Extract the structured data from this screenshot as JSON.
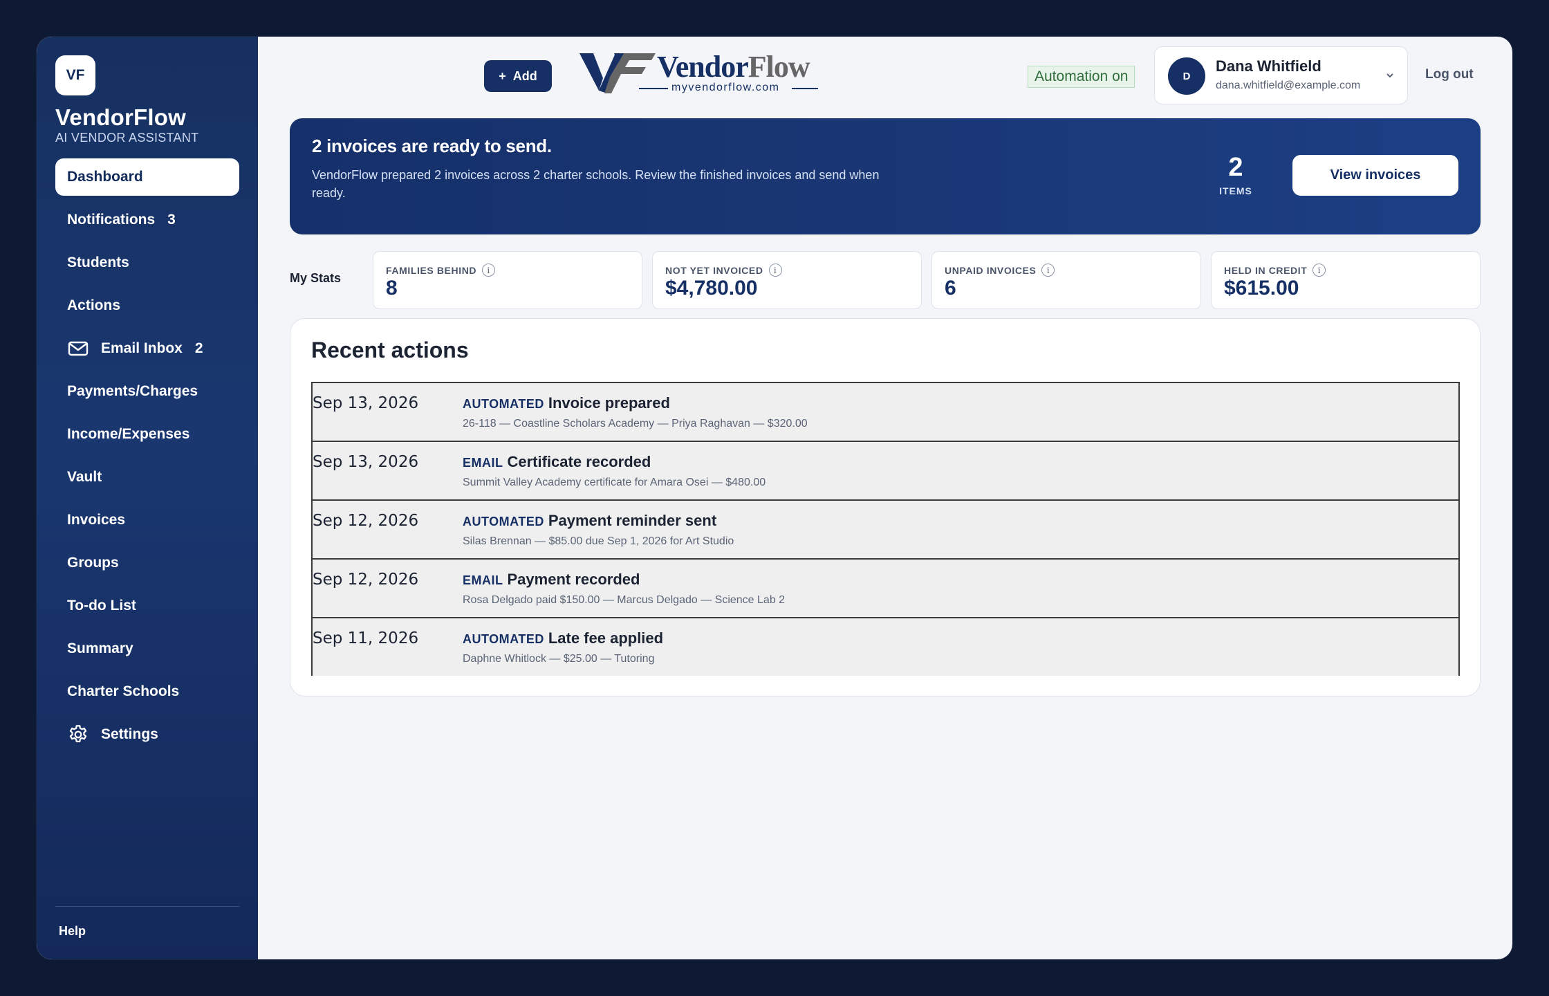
{
  "sidebar": {
    "logo_initials": "VF",
    "brand_name": "VendorFlow",
    "brand_subtitle": "AI VENDOR ASSISTANT",
    "items": [
      {
        "label": "Dashboard",
        "active": true
      },
      {
        "label": "Notifications",
        "count": "3"
      },
      {
        "label": "Students"
      },
      {
        "label": "Actions"
      },
      {
        "label": "Email Inbox",
        "count": "2",
        "icon": "mail-icon"
      },
      {
        "label": "Payments/Charges"
      },
      {
        "label": "Income/Expenses"
      },
      {
        "label": "Vault"
      },
      {
        "label": "Invoices"
      },
      {
        "label": "Groups"
      },
      {
        "label": "To-do List"
      },
      {
        "label": "Summary"
      },
      {
        "label": "Charter Schools"
      },
      {
        "label": "Settings",
        "icon": "gear-icon"
      }
    ],
    "help_label": "Help"
  },
  "header": {
    "add_label": "Add",
    "logo_text": "VendorFlow",
    "logo_url_text": "myvendorflow.com",
    "automation_label": "Automation on",
    "user": {
      "initial": "D",
      "name": "Dana Whitfield",
      "email": "dana.whitfield@example.com"
    },
    "logout_label": "Log out"
  },
  "banner": {
    "title": "2 invoices are ready to send.",
    "text": "VendorFlow prepared 2 invoices across 2 charter schools. Review the finished invoices and send when ready.",
    "count": "2",
    "count_label": "ITEMS",
    "button_label": "View invoices"
  },
  "stats": {
    "label": "My Stats",
    "cards": [
      {
        "label": "FAMILIES BEHIND",
        "value": "8"
      },
      {
        "label": "NOT YET INVOICED",
        "value": "$4,780.00"
      },
      {
        "label": "UNPAID INVOICES",
        "value": "6"
      },
      {
        "label": "HELD IN CREDIT",
        "value": "$615.00"
      }
    ]
  },
  "recent": {
    "title": "Recent actions",
    "rows": [
      {
        "date": "Sep 13, 2026",
        "tag": "AUTOMATED",
        "title": "Invoice prepared",
        "detail": "26-118 — Coastline Scholars Academy — Priya Raghavan — $320.00"
      },
      {
        "date": "Sep 13, 2026",
        "tag": "EMAIL",
        "title": "Certificate recorded",
        "detail": "Summit Valley Academy certificate for Amara Osei — $480.00"
      },
      {
        "date": "Sep 12, 2026",
        "tag": "AUTOMATED",
        "title": "Payment reminder sent",
        "detail": "Silas Brennan — $85.00 due Sep 1, 2026 for Art Studio"
      },
      {
        "date": "Sep 12, 2026",
        "tag": "EMAIL",
        "title": "Payment recorded",
        "detail": "Rosa Delgado paid $150.00 — Marcus Delgado — Science Lab 2"
      },
      {
        "date": "Sep 11, 2026",
        "tag": "AUTOMATED",
        "title": "Late fee applied",
        "detail": "Daphne Whitlock — $25.00 — Tutoring"
      }
    ]
  },
  "colors": {
    "page_bg": "#0e1a33",
    "sidebar": "#1a3770",
    "accent": "#163066",
    "logo_gray": "#666666",
    "automation_green": "#2f6e3c"
  }
}
